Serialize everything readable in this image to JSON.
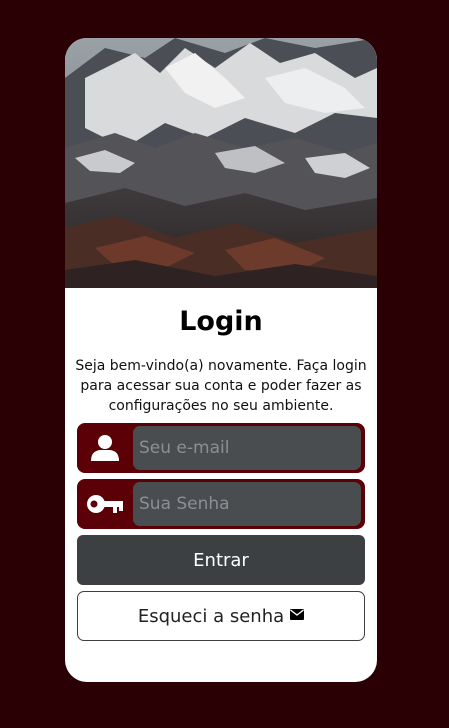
{
  "login": {
    "title": "Login",
    "description": "Seja bem-vindo(a) novamente. Faça login para acessar sua conta e poder fazer as configurações no seu ambiente.",
    "email_placeholder": "Seu e-mail",
    "password_placeholder": "Sua Senha",
    "submit_label": "Entrar",
    "forgot_label": "Esqueci a senha"
  },
  "icons": {
    "user": "user-icon",
    "key": "key-icon",
    "mail": "envelope-icon"
  },
  "colors": {
    "background": "#2a0004",
    "field_accent": "#5a0006",
    "input_bg": "#4a4d50",
    "button": "#3d4043"
  }
}
